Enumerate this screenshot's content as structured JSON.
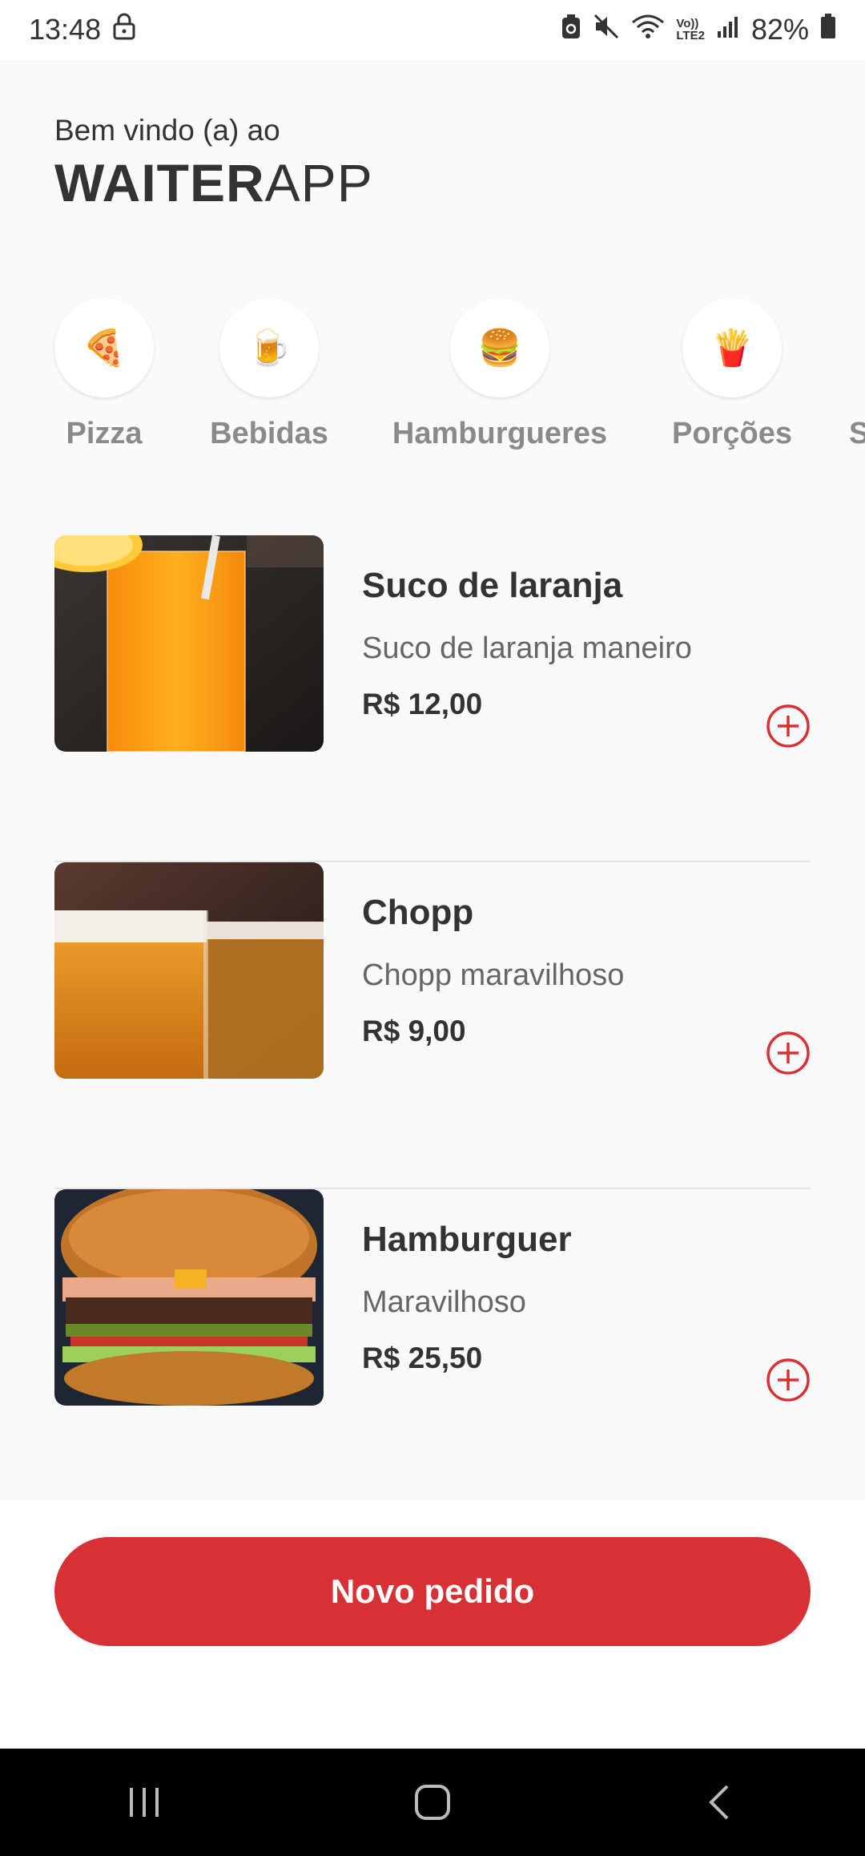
{
  "status_bar": {
    "time": "13:48",
    "battery": "82%",
    "icons": [
      "lock-icon",
      "data-saver-icon",
      "mute-icon",
      "wifi-icon",
      "volte-icon",
      "signal-icon",
      "battery-icon"
    ],
    "volte_text_top": "Vo))",
    "volte_text_bottom": "LTE2"
  },
  "header": {
    "welcome": "Bem vindo (a) ao",
    "brand_bold": "WAITER",
    "brand_light": "APP"
  },
  "categories": [
    {
      "icon": "🍕",
      "label": "Pizza"
    },
    {
      "icon": "🍺",
      "label": "Bebidas"
    },
    {
      "icon": "🍔",
      "label": "Hamburgueres"
    },
    {
      "icon": "🍟",
      "label": "Porções"
    },
    {
      "icon": "",
      "label": "S"
    }
  ],
  "products": [
    {
      "name": "Suco de laranja",
      "description": "Suco de laranja maneiro",
      "price": "R$ 12,00"
    },
    {
      "name": "Chopp",
      "description": "Chopp maravilhoso",
      "price": "R$ 9,00"
    },
    {
      "name": "Hamburguer",
      "description": "Maravilhoso",
      "price": "R$ 25,50"
    }
  ],
  "footer": {
    "button_label": "Novo pedido"
  },
  "colors": {
    "accent": "#d73035",
    "background": "#fafafa",
    "muted_text": "#666666"
  }
}
